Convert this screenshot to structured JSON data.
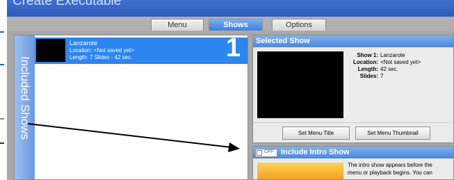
{
  "window": {
    "title": "Create Executable"
  },
  "tabs": [
    {
      "label": "Menu",
      "active": false
    },
    {
      "label": "Shows",
      "active": true
    },
    {
      "label": "Options",
      "active": false
    }
  ],
  "included_shows": {
    "label": "Included Shows",
    "items": [
      {
        "name": "Lanzarote",
        "location": "Location: <Not saved yet>",
        "length": "Length: 7 Slides - 42 sec.",
        "number": "1"
      }
    ]
  },
  "selected_show": {
    "header": "Selected Show",
    "fields": [
      {
        "key": "Show 1:",
        "value": "Lanzarote"
      },
      {
        "key": "Location:",
        "value": "<Not saved yet>"
      },
      {
        "key": "Length:",
        "value": "42 sec."
      },
      {
        "key": "Slides:",
        "value": "7"
      }
    ],
    "buttons": {
      "set_menu_title": "Set Menu Title",
      "set_menu_thumbnail": "Set Menu Thumbnail"
    }
  },
  "intro_show": {
    "toggle_label": "OFF",
    "header": "Include Intro Show",
    "text_lines": [
      "The intro show appears before the",
      "menu or playback begins. You can"
    ]
  },
  "colors": {
    "accent": "#2c86f0",
    "header_blue": "#4b87dc",
    "titlebar": "#2f5cbc"
  }
}
